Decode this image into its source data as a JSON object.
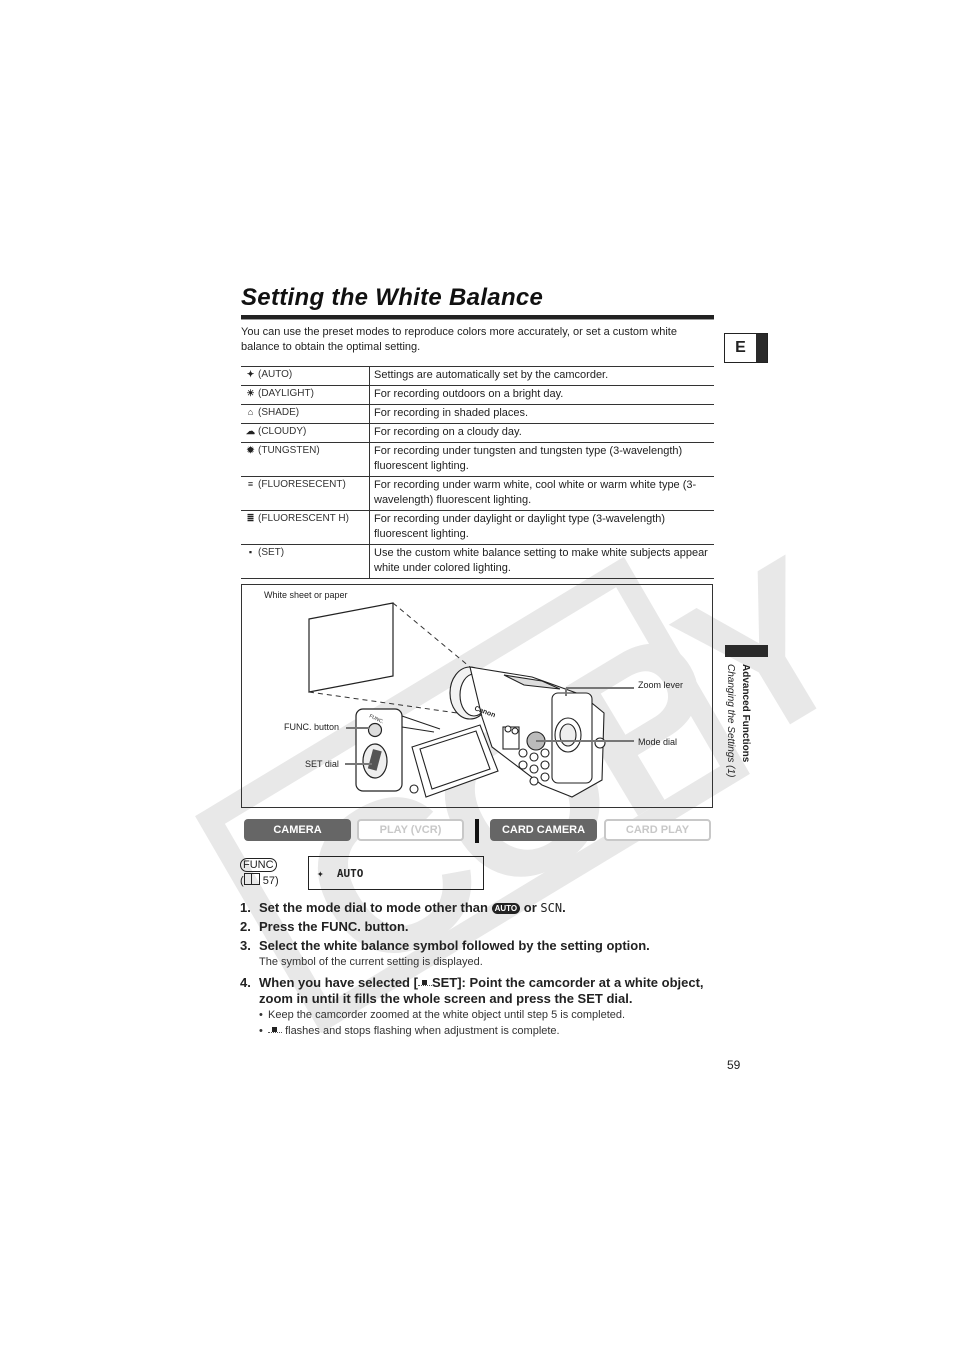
{
  "page": {
    "title": "Setting the White Balance",
    "intro": "You can use the preset modes to reproduce colors more accurately, or set a custom white balance to obtain the optimal setting.",
    "language_tab": "E",
    "page_number": "59",
    "side_section": "Advanced Functions",
    "side_subsection": "Changing the Settings (1)",
    "watermark": "COPY"
  },
  "wb_table": [
    {
      "icon": "awb-icon",
      "glyph": "✦",
      "mode": "(AUTO)",
      "desc": "Settings are automatically set by the camcorder."
    },
    {
      "icon": "daylight-icon",
      "glyph": "☀",
      "mode": "(DAYLIGHT)",
      "desc": "For recording outdoors on a bright day."
    },
    {
      "icon": "shade-icon",
      "glyph": "⌂",
      "mode": "(SHADE)",
      "desc": "For recording in shaded places."
    },
    {
      "icon": "cloudy-icon",
      "glyph": "☁",
      "mode": "(CLOUDY)",
      "desc": "For recording on a cloudy day."
    },
    {
      "icon": "tungsten-icon",
      "glyph": "✹",
      "mode": "(TUNGSTEN)",
      "desc": "For recording under tungsten and tungsten type (3-wavelength) fluorescent lighting."
    },
    {
      "icon": "fluorescent-icon",
      "glyph": "≡",
      "mode": "(FLUORESECENT)",
      "desc": "For recording under warm white, cool white or warm white type (3-wavelength) fluorescent lighting."
    },
    {
      "icon": "fluorescent-h-icon",
      "glyph": "≣",
      "mode": "(FLUORESCENT H)",
      "desc": "For recording under daylight or daylight type (3-wavelength) fluorescent lighting."
    },
    {
      "icon": "custom-set-icon",
      "glyph": "▪",
      "mode": "(SET)",
      "desc": "Use the custom white balance setting to make white subjects appear white under colored lighting."
    }
  ],
  "illustration": {
    "labels": {
      "white_sheet": "White sheet or paper",
      "func_button": "FUNC. button",
      "set_dial": "SET dial",
      "zoom_lever": "Zoom lever",
      "mode_dial": "Mode dial",
      "brand": "Canon",
      "func_small": "FUNC."
    }
  },
  "modes": [
    {
      "label": "CAMERA",
      "active": true
    },
    {
      "label": "PLAY (VCR)",
      "active": false
    },
    {
      "label": "CARD CAMERA",
      "active": true
    },
    {
      "label": "CARD PLAY",
      "active": false
    }
  ],
  "func_ref": {
    "badge": "FUNC",
    "page_ref": "57",
    "menu_value": "AUTO",
    "menu_icon": "awb-icon"
  },
  "steps": [
    {
      "num": "1.",
      "text_a": "Set the mode dial to mode other than",
      "auto": "AUTO",
      "text_b": "or",
      "scn": "SCN",
      "text_c": "."
    },
    {
      "num": "2.",
      "text": "Press the FUNC. button."
    },
    {
      "num": "3.",
      "text": "Select the white balance symbol followed by the setting option.",
      "note": "The symbol of the current setting is displayed."
    },
    {
      "num": "4.",
      "text_a": "When you have selected [",
      "text_b": "SET]: Point the camcorder at a white object, zoom in until it fills the whole screen and press the SET dial.",
      "bullets": [
        {
          "text": "Keep the camcorder zoomed at the white object until step 5 is completed."
        },
        {
          "text": "flashes and stops flashing when adjustment is complete."
        }
      ]
    }
  ],
  "colors": {
    "active_mode_bg": "#666666",
    "inactive_mode": "#c8c8c8",
    "watermark": "#e6e6e6"
  }
}
